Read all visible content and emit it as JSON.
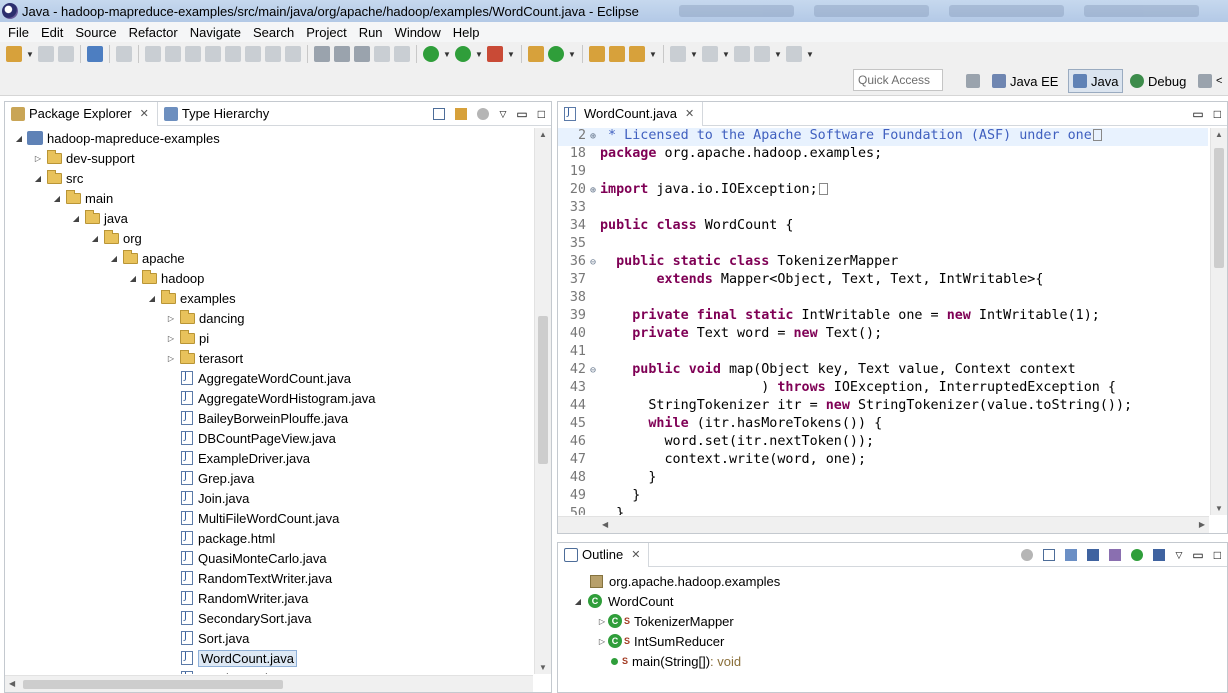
{
  "window": {
    "title": "Java - hadoop-mapreduce-examples/src/main/java/org/apache/hadoop/examples/WordCount.java - Eclipse"
  },
  "menubar": [
    "File",
    "Edit",
    "Source",
    "Refactor",
    "Navigate",
    "Search",
    "Project",
    "Run",
    "Window",
    "Help"
  ],
  "toolbar": {
    "quick_access_placeholder": "Quick Access",
    "perspectives": [
      "Java EE",
      "Java",
      "Debug"
    ],
    "active_perspective": "Java"
  },
  "package_explorer": {
    "tab_label": "Package Explorer",
    "second_tab_label": "Type Hierarchy",
    "tree": [
      {
        "label": "hadoop-mapreduce-examples",
        "level": 0,
        "kind": "project",
        "expanded": true
      },
      {
        "label": "dev-support",
        "level": 1,
        "kind": "folder",
        "expanded": false
      },
      {
        "label": "src",
        "level": 1,
        "kind": "folder",
        "expanded": true
      },
      {
        "label": "main",
        "level": 2,
        "kind": "folder",
        "expanded": true
      },
      {
        "label": "java",
        "level": 3,
        "kind": "folder",
        "expanded": true
      },
      {
        "label": "org",
        "level": 4,
        "kind": "folder",
        "expanded": true
      },
      {
        "label": "apache",
        "level": 5,
        "kind": "folder",
        "expanded": true
      },
      {
        "label": "hadoop",
        "level": 6,
        "kind": "folder",
        "expanded": true
      },
      {
        "label": "examples",
        "level": 7,
        "kind": "folder",
        "expanded": true
      },
      {
        "label": "dancing",
        "level": 8,
        "kind": "folder",
        "expanded": false
      },
      {
        "label": "pi",
        "level": 8,
        "kind": "folder",
        "expanded": false
      },
      {
        "label": "terasort",
        "level": 8,
        "kind": "folder",
        "expanded": false
      },
      {
        "label": "AggregateWordCount.java",
        "level": 8,
        "kind": "file"
      },
      {
        "label": "AggregateWordHistogram.java",
        "level": 8,
        "kind": "file"
      },
      {
        "label": "BaileyBorweinPlouffe.java",
        "level": 8,
        "kind": "file"
      },
      {
        "label": "DBCountPageView.java",
        "level": 8,
        "kind": "file"
      },
      {
        "label": "ExampleDriver.java",
        "level": 8,
        "kind": "file"
      },
      {
        "label": "Grep.java",
        "level": 8,
        "kind": "file"
      },
      {
        "label": "Join.java",
        "level": 8,
        "kind": "file"
      },
      {
        "label": "MultiFileWordCount.java",
        "level": 8,
        "kind": "file"
      },
      {
        "label": "package.html",
        "level": 8,
        "kind": "file"
      },
      {
        "label": "QuasiMonteCarlo.java",
        "level": 8,
        "kind": "file"
      },
      {
        "label": "RandomTextWriter.java",
        "level": 8,
        "kind": "file"
      },
      {
        "label": "RandomWriter.java",
        "level": 8,
        "kind": "file"
      },
      {
        "label": "SecondarySort.java",
        "level": 8,
        "kind": "file"
      },
      {
        "label": "Sort.java",
        "level": 8,
        "kind": "file"
      },
      {
        "label": "WordCount.java",
        "level": 8,
        "kind": "file",
        "selected": true
      },
      {
        "label": "WordMean.java",
        "level": 8,
        "kind": "file"
      }
    ]
  },
  "editor": {
    "tab_label": "WordCount.java",
    "lines": [
      {
        "n": "2",
        "fold": "+",
        "hl": true,
        "parts": [
          [
            "cm",
            " * Licensed to the Apache Software Foundation (ASF) under one"
          ]
        ],
        "box": true
      },
      {
        "n": "18",
        "fold": "",
        "parts": [
          [
            "kw",
            "package"
          ],
          [
            "",
            " org.apache.hadoop.examples;"
          ]
        ]
      },
      {
        "n": "19",
        "fold": "",
        "parts": []
      },
      {
        "n": "20",
        "fold": "+",
        "parts": [
          [
            "kw",
            "import"
          ],
          [
            "",
            " java.io.IOException;"
          ]
        ],
        "box": true
      },
      {
        "n": "33",
        "fold": "",
        "parts": []
      },
      {
        "n": "34",
        "fold": "",
        "parts": [
          [
            "kw",
            "public"
          ],
          [
            "",
            " "
          ],
          [
            "kw",
            "class"
          ],
          [
            "",
            " WordCount {"
          ]
        ]
      },
      {
        "n": "35",
        "fold": "",
        "parts": []
      },
      {
        "n": "36",
        "fold": "-",
        "parts": [
          [
            "",
            "  "
          ],
          [
            "kw",
            "public"
          ],
          [
            "",
            " "
          ],
          [
            "kw",
            "static"
          ],
          [
            "",
            " "
          ],
          [
            "kw",
            "class"
          ],
          [
            "",
            " TokenizerMapper"
          ]
        ]
      },
      {
        "n": "37",
        "fold": "",
        "parts": [
          [
            "",
            "       "
          ],
          [
            "kw",
            "extends"
          ],
          [
            "",
            " Mapper<Object, Text, Text, IntWritable>{"
          ]
        ]
      },
      {
        "n": "38",
        "fold": "",
        "parts": []
      },
      {
        "n": "39",
        "fold": "",
        "parts": [
          [
            "",
            "    "
          ],
          [
            "kw",
            "private"
          ],
          [
            "",
            " "
          ],
          [
            "kw",
            "final"
          ],
          [
            "",
            " "
          ],
          [
            "kw",
            "static"
          ],
          [
            "",
            " IntWritable one = "
          ],
          [
            "kw",
            "new"
          ],
          [
            "",
            " IntWritable(1);"
          ]
        ]
      },
      {
        "n": "40",
        "fold": "",
        "parts": [
          [
            "",
            "    "
          ],
          [
            "kw",
            "private"
          ],
          [
            "",
            " Text word = "
          ],
          [
            "kw",
            "new"
          ],
          [
            "",
            " Text();"
          ]
        ]
      },
      {
        "n": "41",
        "fold": "",
        "parts": []
      },
      {
        "n": "42",
        "fold": "-",
        "parts": [
          [
            "",
            "    "
          ],
          [
            "kw",
            "public"
          ],
          [
            "",
            " "
          ],
          [
            "kw",
            "void"
          ],
          [
            "",
            " map(Object key, Text value, Context context"
          ]
        ]
      },
      {
        "n": "43",
        "fold": "",
        "parts": [
          [
            "",
            "                    ) "
          ],
          [
            "kw",
            "throws"
          ],
          [
            "",
            " IOException, InterruptedException {"
          ]
        ]
      },
      {
        "n": "44",
        "fold": "",
        "parts": [
          [
            "",
            "      StringTokenizer itr = "
          ],
          [
            "kw",
            "new"
          ],
          [
            "",
            " StringTokenizer(value.toString());"
          ]
        ]
      },
      {
        "n": "45",
        "fold": "",
        "parts": [
          [
            "",
            "      "
          ],
          [
            "kw",
            "while"
          ],
          [
            "",
            " (itr.hasMoreTokens()) {"
          ]
        ]
      },
      {
        "n": "46",
        "fold": "",
        "parts": [
          [
            "",
            "        word.set(itr.nextToken());"
          ]
        ]
      },
      {
        "n": "47",
        "fold": "",
        "parts": [
          [
            "",
            "        context.write(word, one);"
          ]
        ]
      },
      {
        "n": "48",
        "fold": "",
        "parts": [
          [
            "",
            "      }"
          ]
        ]
      },
      {
        "n": "49",
        "fold": "",
        "parts": [
          [
            "",
            "    }"
          ]
        ]
      },
      {
        "n": "50",
        "fold": "",
        "parts": [
          [
            "",
            "  }"
          ]
        ]
      }
    ]
  },
  "outline": {
    "tab_label": "Outline",
    "package": "org.apache.hadoop.examples",
    "class_name": "WordCount",
    "members": [
      {
        "label": "TokenizerMapper",
        "kind": "class",
        "static_marker": "S"
      },
      {
        "label": "IntSumReducer",
        "kind": "class",
        "static_marker": "S"
      },
      {
        "label": "main(String[])",
        "kind": "method",
        "static_marker": "S",
        "return_type": " : void"
      }
    ]
  }
}
